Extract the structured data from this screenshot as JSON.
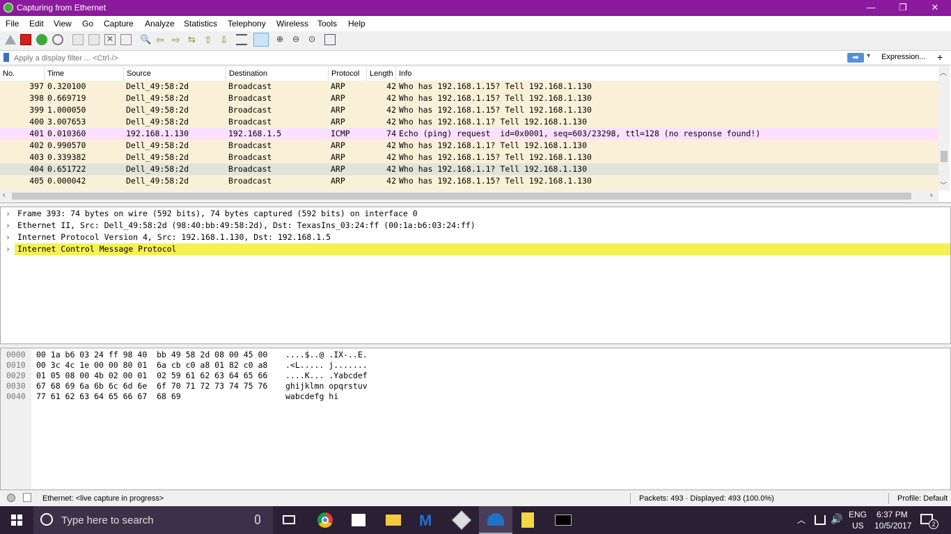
{
  "window": {
    "title": "Capturing from Ethernet"
  },
  "menu": [
    "File",
    "Edit",
    "View",
    "Go",
    "Capture",
    "Analyze",
    "Statistics",
    "Telephony",
    "Wireless",
    "Tools",
    "Help"
  ],
  "filter": {
    "placeholder": "Apply a display filter ... <Ctrl-/>",
    "expression_label": "Expression...",
    "add_label": "+"
  },
  "columns": [
    "No.",
    "Time",
    "Source",
    "Destination",
    "Protocol",
    "Length",
    "Info"
  ],
  "packets": [
    {
      "no": "397",
      "time": "0.320100",
      "src": "Dell_49:58:2d",
      "dst": "Broadcast",
      "proto": "ARP",
      "len": "42",
      "info": "Who has 192.168.1.15? Tell 192.168.1.130",
      "color": "#faf0d7"
    },
    {
      "no": "398",
      "time": "0.669719",
      "src": "Dell_49:58:2d",
      "dst": "Broadcast",
      "proto": "ARP",
      "len": "42",
      "info": "Who has 192.168.1.15? Tell 192.168.1.130",
      "color": "#faf0d7"
    },
    {
      "no": "399",
      "time": "1.000050",
      "src": "Dell_49:58:2d",
      "dst": "Broadcast",
      "proto": "ARP",
      "len": "42",
      "info": "Who has 192.168.1.15? Tell 192.168.1.130",
      "color": "#faf0d7"
    },
    {
      "no": "400",
      "time": "3.007653",
      "src": "Dell_49:58:2d",
      "dst": "Broadcast",
      "proto": "ARP",
      "len": "42",
      "info": "Who has 192.168.1.1? Tell 192.168.1.130",
      "color": "#faf0d7"
    },
    {
      "no": "401",
      "time": "0.010360",
      "src": "192.168.1.130",
      "dst": "192.168.1.5",
      "proto": "ICMP",
      "len": "74",
      "info": "Echo (ping) request  id=0x0001, seq=603/23298, ttl=128 (no response found!)",
      "color": "#fce0ff"
    },
    {
      "no": "402",
      "time": "0.990570",
      "src": "Dell_49:58:2d",
      "dst": "Broadcast",
      "proto": "ARP",
      "len": "42",
      "info": "Who has 192.168.1.1? Tell 192.168.1.130",
      "color": "#faf0d7"
    },
    {
      "no": "403",
      "time": "0.339382",
      "src": "Dell_49:58:2d",
      "dst": "Broadcast",
      "proto": "ARP",
      "len": "42",
      "info": "Who has 192.168.1.15? Tell 192.168.1.130",
      "color": "#faf0d7"
    },
    {
      "no": "404",
      "time": "0.651722",
      "src": "Dell_49:58:2d",
      "dst": "Broadcast",
      "proto": "ARP",
      "len": "42",
      "info": "Who has 192.168.1.1? Tell 192.168.1.130",
      "color": "#e0e4d8"
    },
    {
      "no": "405",
      "time": "0.000042",
      "src": "Dell_49:58:2d",
      "dst": "Broadcast",
      "proto": "ARP",
      "len": "42",
      "info": "Who has 192.168.1.15? Tell 192.168.1.130",
      "color": "#faf0d7"
    }
  ],
  "details": [
    {
      "text": "Frame 393: 74 bytes on wire (592 bits), 74 bytes captured (592 bits) on interface 0",
      "highlight": false
    },
    {
      "text": "Ethernet II, Src: Dell_49:58:2d (98:40:bb:49:58:2d), Dst: TexasIns_03:24:ff (00:1a:b6:03:24:ff)",
      "highlight": false
    },
    {
      "text": "Internet Protocol Version 4, Src: 192.168.1.130, Dst: 192.168.1.5",
      "highlight": false
    },
    {
      "text": "Internet Control Message Protocol",
      "highlight": true
    }
  ],
  "bytes": [
    {
      "offset": "0000",
      "hex": "00 1a b6 03 24 ff 98 40  bb 49 58 2d 08 00 45 00",
      "ascii": "....$..@ .IX-..E."
    },
    {
      "offset": "0010",
      "hex": "00 3c 4c 1e 00 00 80 01  6a cb c0 a8 01 82 c0 a8",
      "ascii": ".<L..... j......."
    },
    {
      "offset": "0020",
      "hex": "01 05 08 00 4b 02 00 01  02 59 61 62 63 64 65 66",
      "ascii": "....K... .Yabcdef"
    },
    {
      "offset": "0030",
      "hex": "67 68 69 6a 6b 6c 6d 6e  6f 70 71 72 73 74 75 76",
      "ascii": "ghijklmn opqrstuv"
    },
    {
      "offset": "0040",
      "hex": "77 61 62 63 64 65 66 67  68 69",
      "ascii": "wabcdefg hi"
    }
  ],
  "status": {
    "capture": "Ethernet: <live capture in progress>",
    "packets": "Packets: 493 · Displayed: 493 (100.0%)",
    "profile": "Profile: Default"
  },
  "taskbar": {
    "search_placeholder": "Type here to search",
    "lang": "ENG",
    "region": "US",
    "time": "6:37 PM",
    "date": "10/5/2017",
    "notification_count": "2"
  },
  "colors": {
    "titlebar": "#8b1a9c",
    "highlight": "#f5f056",
    "taskbar": "#2b1f33"
  }
}
